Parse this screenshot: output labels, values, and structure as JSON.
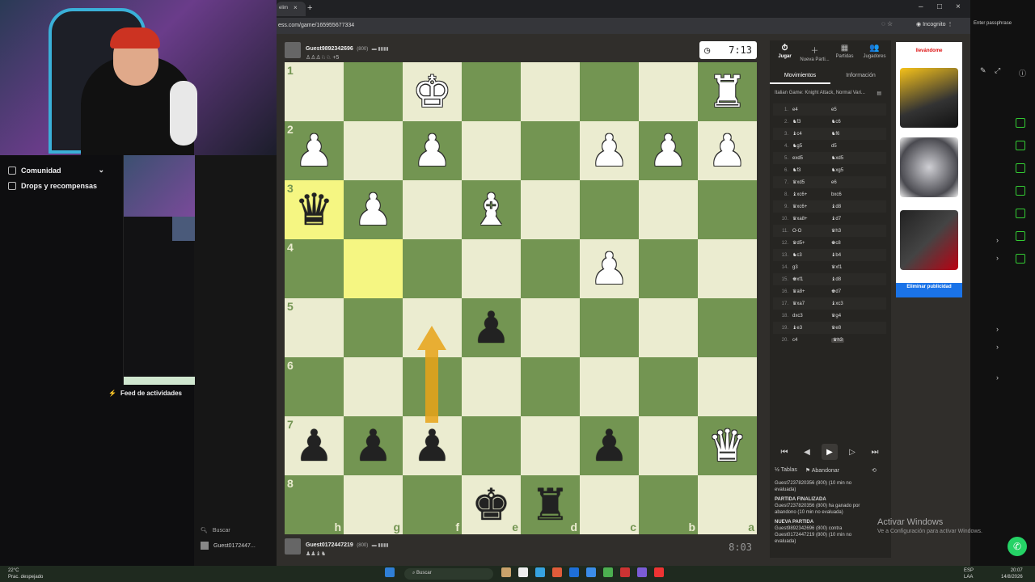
{
  "browser": {
    "tab_label": "elim",
    "tab_close": "×",
    "new_tab": "+",
    "url": "ess.com/game/165955677334",
    "incognito": "Incognito",
    "win_min": "–",
    "win_max": "□",
    "win_close": "×"
  },
  "sidebar": {
    "items": [
      {
        "label": "Comunidad"
      },
      {
        "label": "Drops y recompensas"
      }
    ],
    "feed": "Feed de actividades",
    "search": "Buscar",
    "guest": "Guest0172447..."
  },
  "top_player": {
    "name": "Guest9892342696",
    "rating": "(800)",
    "captured": "+5",
    "clock": "7:13"
  },
  "bottom_player": {
    "name": "Guest0172447219",
    "rating": "(800)",
    "captured": "♟♟♝♞",
    "clock": "8:03"
  },
  "board": {
    "ranks": [
      "1",
      "2",
      "3",
      "4",
      "5",
      "6",
      "7",
      "8"
    ],
    "files": [
      "h",
      "g",
      "f",
      "e",
      "d",
      "c",
      "b",
      "a"
    ],
    "highlight": [
      "3-0",
      "4-1"
    ],
    "pieces": {
      "1-2": {
        "g": "♚",
        "c": "w"
      },
      "1-7": {
        "g": "♜",
        "c": "w"
      },
      "2-0": {
        "g": "♟",
        "c": "w"
      },
      "2-2": {
        "g": "♟",
        "c": "w"
      },
      "2-5": {
        "g": "♟",
        "c": "w"
      },
      "2-6": {
        "g": "♟",
        "c": "w"
      },
      "2-7": {
        "g": "♟",
        "c": "w"
      },
      "3-0": {
        "g": "♛",
        "c": "b"
      },
      "3-1": {
        "g": "♟",
        "c": "w"
      },
      "3-3": {
        "g": "♝",
        "c": "w"
      },
      "4-5": {
        "g": "♟",
        "c": "w"
      },
      "5-3": {
        "g": "♟",
        "c": "b"
      },
      "7-0": {
        "g": "♟",
        "c": "b"
      },
      "7-1": {
        "g": "♟",
        "c": "b"
      },
      "7-2": {
        "g": "♟",
        "c": "b"
      },
      "7-5": {
        "g": "♟",
        "c": "b"
      },
      "7-7": {
        "g": "♛",
        "c": "w"
      },
      "8-3": {
        "g": "♚",
        "c": "b"
      },
      "8-4": {
        "g": "♜",
        "c": "b"
      }
    }
  },
  "side_tabs": [
    {
      "icon": "⏱",
      "label": "Jugar"
    },
    {
      "icon": "＋",
      "label": "Nueva Parti..."
    },
    {
      "icon": "▦",
      "label": "Partidas"
    },
    {
      "icon": "👥",
      "label": "Jugadores"
    }
  ],
  "subtabs": [
    "Movimientos",
    "Información"
  ],
  "opening": "Italian Game: Knight Attack, Normal Vari...",
  "moves": [
    [
      "1.",
      "e4",
      "e5"
    ],
    [
      "2.",
      "♞f3",
      "♞c6"
    ],
    [
      "3.",
      "♝c4",
      "♞f6"
    ],
    [
      "4.",
      "♞g5",
      "d5"
    ],
    [
      "5.",
      "exd5",
      "♞xd5"
    ],
    [
      "6.",
      "♞f3",
      "♞xg5"
    ],
    [
      "7.",
      "♛xd5",
      "e6"
    ],
    [
      "8.",
      "♝xc6+",
      "bxc6"
    ],
    [
      "9.",
      "♛xc6+",
      "♝d8"
    ],
    [
      "10.",
      "♛xa8+",
      "♝d7"
    ],
    [
      "11.",
      "O-O",
      "♛h3"
    ],
    [
      "12.",
      "♛d5+",
      "♚c8"
    ],
    [
      "13.",
      "♞c3",
      "♝b4"
    ],
    [
      "14.",
      "g3",
      "♛xf1"
    ],
    [
      "15.",
      "♚xf1",
      "♝d8"
    ],
    [
      "16.",
      "♛a8+",
      "♚d7"
    ],
    [
      "17.",
      "♛xa7",
      "♝xc3"
    ],
    [
      "18.",
      "dxc3",
      "♛g4"
    ],
    [
      "19.",
      "♝e3",
      "♛e8"
    ],
    [
      "20.",
      "c4",
      "♛h3"
    ]
  ],
  "nav": [
    "⏮",
    "◀",
    "▶",
    "▷",
    "⏭"
  ],
  "actions": {
    "draw": "½ Tablas",
    "resign": "⚑ Abandonar"
  },
  "chat": [
    {
      "head": "",
      "text": "Guest7237820356 (800) (10 min no evaluada)"
    },
    {
      "head": "PARTIDA FINALIZADA",
      "text": "Guest7237820356 (800) ha ganado por abandono (10 min no evaluada)"
    },
    {
      "head": "NUEVA PARTIDA",
      "text": "Guest9892342696 (800) contra Guest0172447219 (800) (10 min no evaluada)"
    }
  ],
  "ad": {
    "heading": "llevándome",
    "cta": "Eliminar publicidad"
  },
  "right_panel": {
    "passphrase": "Enter passphrase"
  },
  "activate": {
    "title": "Activar Windows",
    "sub": "Ve a Configuración para activar Windows."
  },
  "taskbar": {
    "weather": "22°C",
    "weather_sub": "Prac. despejado",
    "search": "Buscar",
    "lang": "ESP",
    "lang_sub": "LAA",
    "time": "20:07",
    "date": "14/8/2026"
  },
  "colors": {
    "light_square": "#ebecd0",
    "dark_square": "#739552",
    "highlight": "#f5f682",
    "arrow": "#e8a317"
  }
}
